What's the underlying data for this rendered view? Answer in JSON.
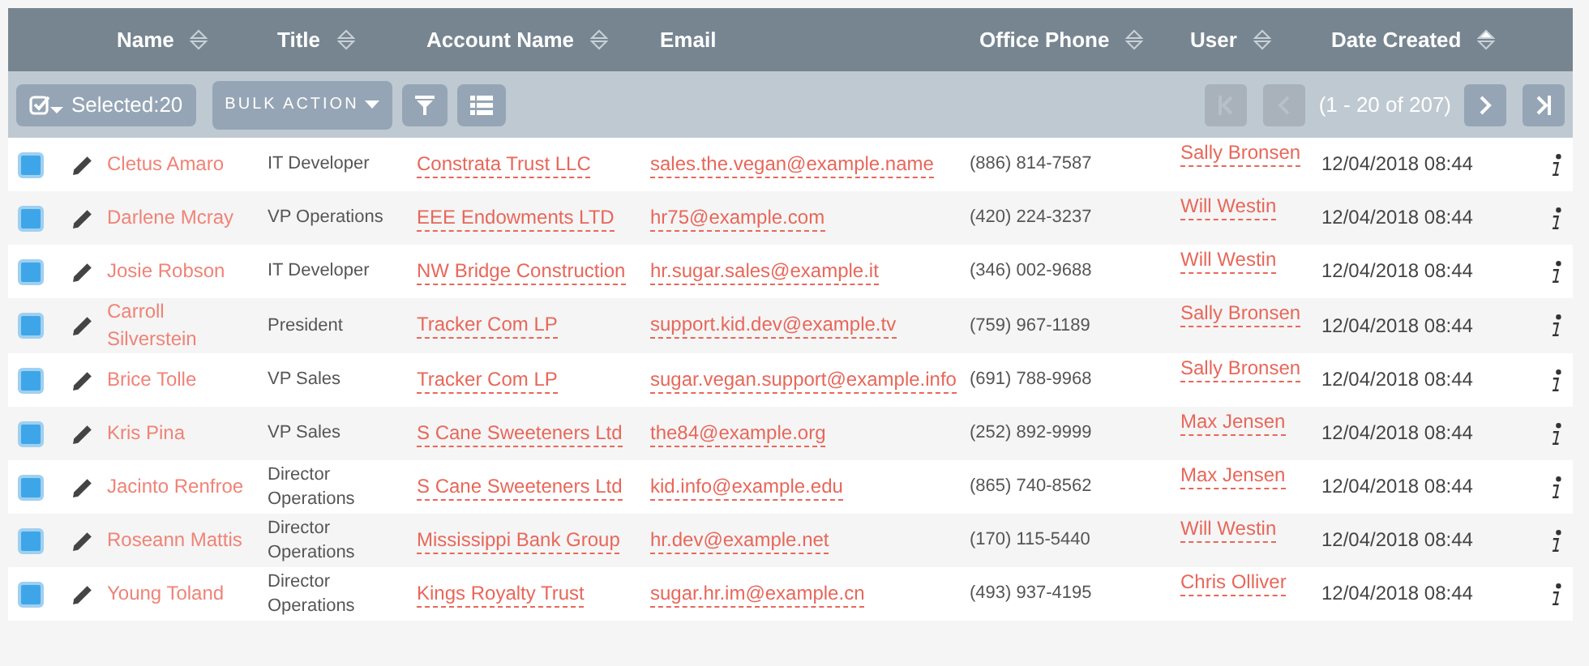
{
  "columns": [
    {
      "label": "Name",
      "sorted_ascending": false
    },
    {
      "label": "Title",
      "sorted_ascending": false
    },
    {
      "label": "Account Name",
      "sorted_ascending": false
    },
    {
      "label": "Email"
    },
    {
      "label": "Office Phone",
      "sorted_ascending": false
    },
    {
      "label": "User",
      "sorted_ascending": false
    },
    {
      "label": "Date Created",
      "sorted_ascending": true
    }
  ],
  "toolbar": {
    "selected_label": "Selected:",
    "selected_count": "20",
    "bulk_action": "BULK ACTION",
    "page_info": "(1 - 20 of 207)",
    "pager": [
      {
        "kind": "first",
        "disabled": true
      },
      {
        "kind": "prev",
        "disabled": true
      },
      {
        "kind": "info"
      },
      {
        "kind": "next",
        "disabled": false
      },
      {
        "kind": "last",
        "disabled": false
      }
    ]
  },
  "rows": [
    {
      "checked": true,
      "name": "Cletus Amaro",
      "title": "IT Developer",
      "account": "Constrata Trust LLC",
      "email": "sales.the.vegan@example.name",
      "phone": "(886) 814-7587",
      "user": "Sally Bronsen",
      "date": "12/04/2018 08:44"
    },
    {
      "checked": true,
      "name": "Darlene Mcray",
      "title": "VP Operations",
      "account": "EEE Endowments LTD",
      "email": "hr75@example.com",
      "phone": "(420) 224-3237",
      "user": "Will Westin",
      "date": "12/04/2018 08:44"
    },
    {
      "checked": true,
      "name": "Josie Robson",
      "title": "IT Developer",
      "account": "NW Bridge Construction",
      "email": "hr.sugar.sales@example.it",
      "phone": "(346) 002-9688",
      "user": "Will Westin",
      "date": "12/04/2018 08:44"
    },
    {
      "checked": true,
      "name": "Carroll Silverstein",
      "title": "President",
      "account": "Tracker Com LP",
      "email": "support.kid.dev@example.tv",
      "phone": "(759) 967-1189",
      "user": "Sally Bronsen",
      "date": "12/04/2018 08:44"
    },
    {
      "checked": true,
      "name": "Brice Tolle",
      "title": "VP Sales",
      "account": "Tracker Com LP",
      "email": "sugar.vegan.support@example.info",
      "phone": "(691) 788-9968",
      "user": "Sally Bronsen",
      "date": "12/04/2018 08:44"
    },
    {
      "checked": true,
      "name": "Kris Pina",
      "title": "VP Sales",
      "account": "S Cane Sweeteners Ltd",
      "email": "the84@example.org",
      "phone": "(252) 892-9999",
      "user": "Max Jensen",
      "date": "12/04/2018 08:44"
    },
    {
      "checked": true,
      "name": "Jacinto Renfroe",
      "title": "Director Operations",
      "account": "S Cane Sweeteners Ltd",
      "email": "kid.info@example.edu",
      "phone": "(865) 740-8562",
      "user": "Max Jensen",
      "date": "12/04/2018 08:44"
    },
    {
      "checked": true,
      "name": "Roseann Mattis",
      "title": "Director Operations",
      "account": "Mississippi Bank Group",
      "email": "hr.dev@example.net",
      "phone": "(170) 115-5440",
      "user": "Will Westin",
      "date": "12/04/2018 08:44"
    },
    {
      "checked": true,
      "name": "Young Toland",
      "title": "Director Operations",
      "account": "Kings Royalty Trust",
      "email": "sugar.hr.im@example.cn",
      "phone": "(493) 937-4195",
      "user": "Chris Olliver",
      "date": "12/04/2018 08:44"
    }
  ]
}
